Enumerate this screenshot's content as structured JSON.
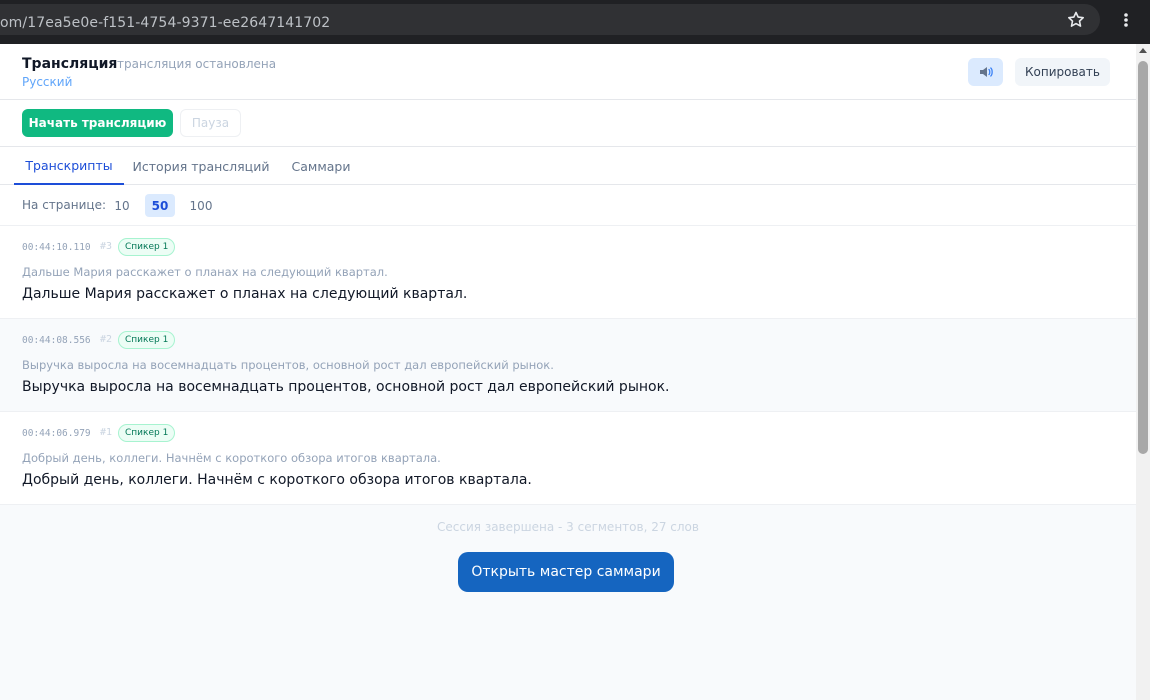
{
  "browser": {
    "url": "om/17ea5e0e-f151-4754-9371-ee2647141702"
  },
  "header": {
    "title": "Трансляция",
    "status": "трансляция остановлена",
    "language": "Русский",
    "audio_icon": "speaker-icon",
    "copy_label": "Копировать"
  },
  "controls": {
    "start_label": "Начать трансляцию",
    "pause_label": "Пауза"
  },
  "tabs": [
    {
      "label": "Транскрипты",
      "active": true
    },
    {
      "label": "История трансляций",
      "active": false
    },
    {
      "label": "Саммари",
      "active": false
    }
  ],
  "pager": {
    "label": "На странице:",
    "options": [
      "10",
      "50",
      "100"
    ],
    "selected": "50"
  },
  "segments": [
    {
      "time": "00:44:10.110",
      "num": "#3",
      "speaker": "Спикер 1",
      "interim": "Дальше Мария расскажет о планах на следующий квартал.",
      "text": "Дальше Мария расскажет о планах на следующий квартал."
    },
    {
      "time": "00:44:08.556",
      "num": "#2",
      "speaker": "Спикер 1",
      "interim": "Выручка выросла на восемнадцать процентов, основной рост дал европейский рынок.",
      "text": "Выручка выросла на восемнадцать процентов, основной рост дал европейский рынок."
    },
    {
      "time": "00:44:06.979",
      "num": "#1",
      "speaker": "Спикер 1",
      "interim": "Добрый день, коллеги. Начнём с короткого обзора итогов квартала.",
      "text": "Добрый день, коллеги. Начнём с короткого обзора итогов квартала."
    }
  ],
  "footer": {
    "summary": "Сессия завершена - 3 сегментов, 27 слов",
    "wizard_label": "Открыть мастер саммари"
  },
  "colors": {
    "accent": "#1565c0",
    "start": "#10b981",
    "speaker_badge": "#ecfdf5"
  }
}
